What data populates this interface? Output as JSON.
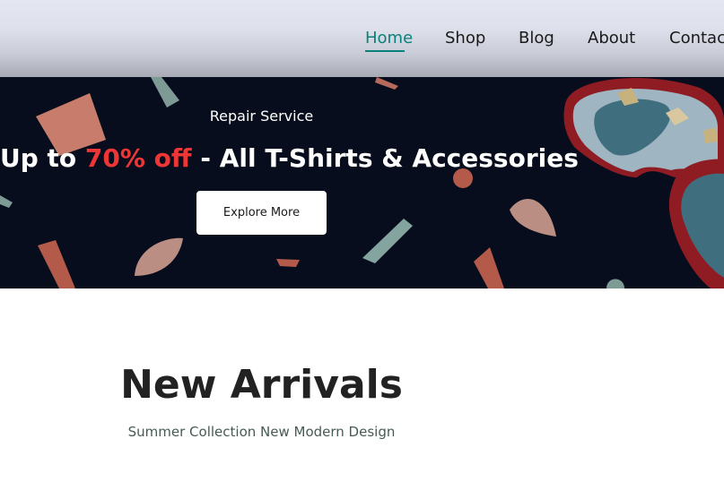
{
  "nav": {
    "items": [
      {
        "label": "Home",
        "active": true
      },
      {
        "label": "Shop",
        "active": false
      },
      {
        "label": "Blog",
        "active": false
      },
      {
        "label": "About",
        "active": false
      },
      {
        "label": "Contact",
        "active": false
      }
    ]
  },
  "hero": {
    "subtitle": "Repair Service",
    "title_prefix": "Up to ",
    "title_highlight": "70% off",
    "title_suffix": " - All T-Shirts & Accessories",
    "button_label": "Explore More",
    "image": "sunglasses-and-confetti"
  },
  "arrivals": {
    "title": "New Arrivals",
    "subtitle": "Summer Collection New Modern Design"
  },
  "colors": {
    "accent": "#088178",
    "highlight": "#ef3636",
    "hero_bg": "#070d1c"
  }
}
